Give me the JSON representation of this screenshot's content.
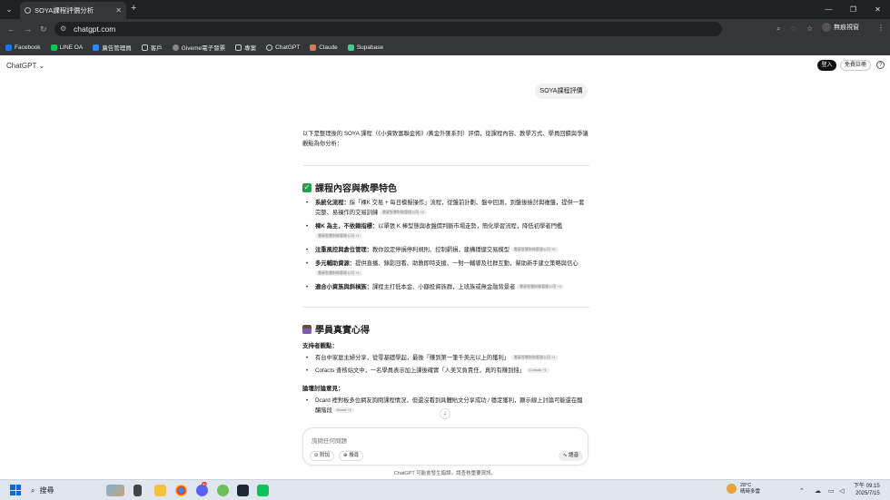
{
  "browser": {
    "tab_title": "SOYA課程評價分析",
    "url": "chatgpt.com",
    "incognito_label": "無痕視窗",
    "bookmarks": [
      "Facebook",
      "LINE OA",
      "廣告管理員",
      "客戶",
      "Giveme電子發票",
      "專案",
      "ChatGPT",
      "Claude",
      "Supabase"
    ]
  },
  "app": {
    "brand": "ChatGPT",
    "login_label": "登入",
    "signup_label": "免費註冊",
    "help_label": "?"
  },
  "user_message": "SOYA課程評價",
  "response": {
    "intro": "以下是整理後的 SOYA 課程（《小資致富聯金術》/黃金外匯系列）評價，從課程內容、教學方式、學員回饋與爭議觀點為你分析：",
    "section1_title": "課程內容與教學特色",
    "section1_items": [
      {
        "bold": "系統化流程：",
        "text": "採「裸K 交易 + 每日模擬操作」流程，從盤前計劃、盤中回測，到盤後檢討與複盤，提供一套完整、易操作的交易訓練",
        "cite": "雲豪智慧財務管理公司 +3"
      },
      {
        "bold": "裸K 為主，不依賴指標：",
        "text": "以單張 K 棒型態與收盤價判斷市場走勢，簡化學習流程，降低初學者門檻",
        "cite": "雲豪智慧財務管理公司 +1"
      },
      {
        "bold": "注重風控與倉位管理：",
        "text": "教你設定停損停利規則、控制虧損，建構穩健交易模型",
        "cite": "雲豪智慧財務管理公司 +2"
      },
      {
        "bold": "多元輔助資源：",
        "text": "提供直播、錄影回看、助教即時支援、一對一輔導及社群互動，幫助新手建立策略與信心",
        "cite": "雲豪智慧財務管理公司 +1"
      },
      {
        "bold": "適合小資族與斜槓族：",
        "text": "課程主打低本金、小額投資族群，上班族或無金融背景者",
        "cite": "雲豪智慧財務管理公司 +4"
      }
    ],
    "section2_title": "學員真實心得",
    "supporters_label": "支持者觀點：",
    "supporters": [
      {
        "text": "有台中家庭主婦分享，從零基礎學起，最後「賺到第一筆千美元以上的獲利」",
        "cite": "雲豪智慧財務管理公司 +1"
      },
      {
        "text": "Cofacts 查核站文中，一名學員表示加上課後確實「人美又負責任，真的有賺到錢」",
        "cite": "Cofacts +1"
      }
    ],
    "discussion_label": "論壇討論意見：",
    "discussion": [
      {
        "text": "Dcard 裡對板多位網友詢問課程情況，但還沒看到具體貼文分享成功 / 穩定獲利，顯示線上討論可能還在醞釀階段",
        "cite": "Dcard +1"
      }
    ]
  },
  "composer": {
    "placeholder": "詢問任何問題",
    "attach_label": "附加",
    "search_label": "搜尋",
    "voice_label": "語音"
  },
  "disclaimer": "ChatGPT 可能會發生錯誤。請查核重要資訊。",
  "taskbar": {
    "search_label": "搜尋",
    "weather_temp": "28°C",
    "weather_desc": "晴時多雲",
    "time": "下午 09:15",
    "date": "2025/7/15",
    "notif_count": "99"
  }
}
